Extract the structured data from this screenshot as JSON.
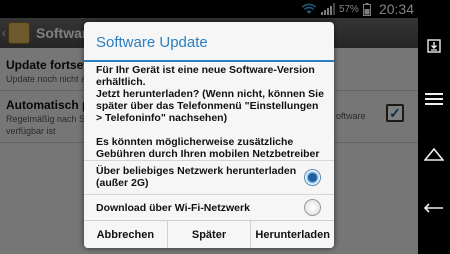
{
  "status_bar": {
    "battery_text": "57%",
    "time": "20:34",
    "icons": [
      "wifi-icon",
      "signal-icon",
      "battery-icon"
    ]
  },
  "background_app": {
    "title": "Software U",
    "settings": [
      {
        "title": "Update fortsetze",
        "subtitle": "Update noch nicht ab"
      },
      {
        "title": "Automatisch prü",
        "subtitle": "Regelmäßig nach Sof",
        "subtitle_right": "oftware",
        "subtitle2": "verfügbar ist"
      }
    ]
  },
  "dialog": {
    "title": "Software Update",
    "accent_color": "#2a7fc1",
    "message": [
      "Für Ihr Gerät ist eine neue Software-Version erhältlich.",
      "Jetzt herunterladen? (Wenn nicht, können Sie später über das Telefonmenü \"Einstellungen > Telefoninfo\" nachsehen)",
      "Es könnten möglicherweise zusätzliche Gebühren durch Ihren mobilen Netzbetreiber"
    ],
    "options": [
      {
        "label_line1": "Über beliebiges Netzwerk herunterladen",
        "label_line2": "(außer 2G)",
        "selected": true
      },
      {
        "label_line1": "Download über Wi-Fi-Netzwerk",
        "selected": false
      }
    ],
    "buttons": {
      "cancel": "Abbrechen",
      "later": "Später",
      "download": "Herunterladen"
    }
  },
  "nav_bar": {
    "icons": [
      "notifications-icon",
      "menu-icon",
      "home-icon",
      "back-icon"
    ]
  }
}
